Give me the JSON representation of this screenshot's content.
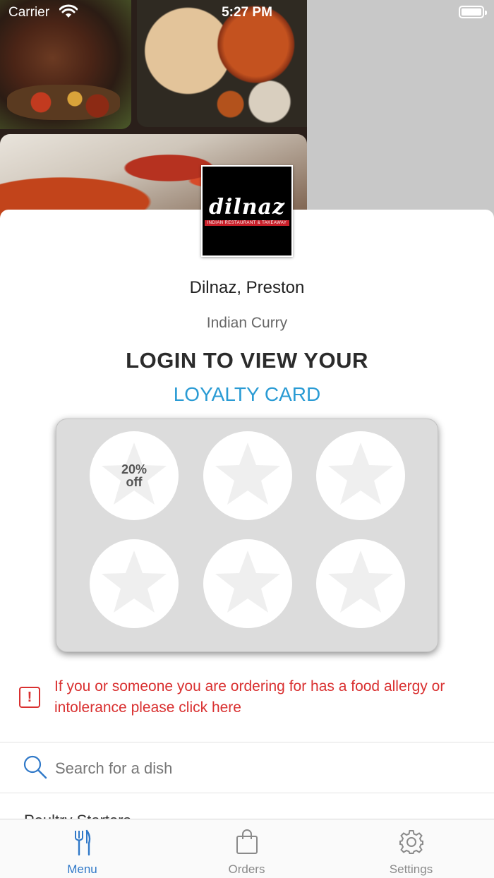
{
  "status_bar": {
    "carrier": "Carrier",
    "time": "5:27 PM"
  },
  "restaurant": {
    "logo_word": "dilnaz",
    "logo_tagline": "INDIAN RESTAURANT & TAKEAWAY",
    "name": "Dilnaz, Preston",
    "cuisine": "Indian Curry"
  },
  "loyalty": {
    "heading": "LOGIN TO VIEW YOUR",
    "subheading": "LOYALTY CARD",
    "reward_line1": "20%",
    "reward_line2": "off",
    "stamps_total": 6
  },
  "allergy": {
    "icon": "alert-icon",
    "text": "If you or someone you are ordering for has a food allergy or intolerance please click here"
  },
  "search": {
    "placeholder": "Search for a dish"
  },
  "category_peek": "Poultry Starters",
  "tabs": [
    {
      "label": "Menu",
      "icon": "fork-knife-icon",
      "active": true
    },
    {
      "label": "Orders",
      "icon": "shopping-bag-icon",
      "active": false
    },
    {
      "label": "Settings",
      "icon": "gear-icon",
      "active": false
    }
  ],
  "colors": {
    "accent": "#2a9bd4",
    "tab_active": "#2f78c8",
    "alert": "#d93030"
  }
}
